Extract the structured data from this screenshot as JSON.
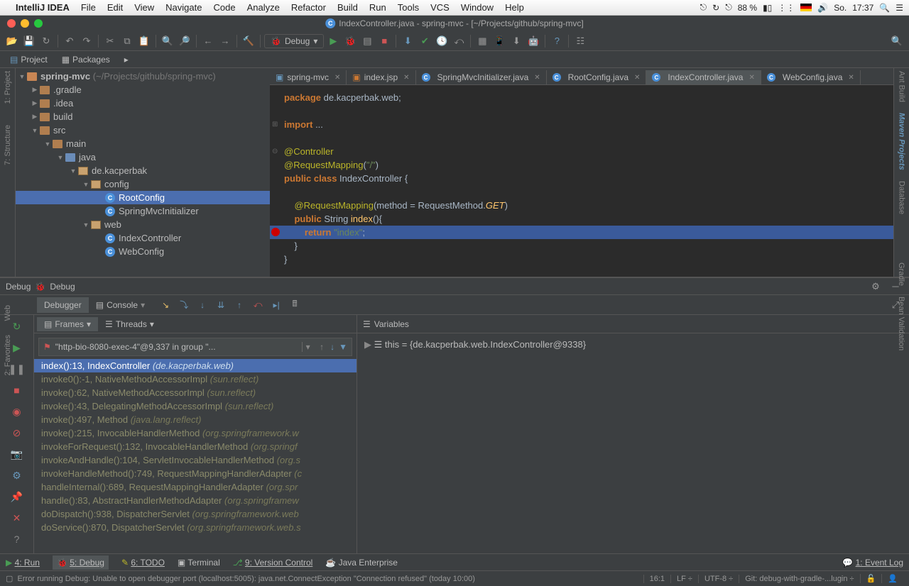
{
  "mac": {
    "app": "IntelliJ IDEA",
    "menus": [
      "File",
      "Edit",
      "View",
      "Navigate",
      "Code",
      "Analyze",
      "Refactor",
      "Build",
      "Run",
      "Tools",
      "VCS",
      "Window",
      "Help"
    ],
    "battery": "88 %",
    "day": "So.",
    "time": "17:37"
  },
  "window": {
    "title": "IndexController.java - spring-mvc - [~/Projects/github/spring-mvc]"
  },
  "toolbar": {
    "debug_config": "Debug"
  },
  "nav": {
    "project": "Project",
    "packages": "Packages"
  },
  "side": {
    "project": "1: Project",
    "structure": "7: Structure",
    "web": "Web",
    "favorites": "2: Favorites",
    "ant": "Ant Build",
    "maven": "Maven Projects",
    "database": "Database",
    "gradle": "Gradle",
    "bean": "Bean Validation"
  },
  "tree": {
    "root": "spring-mvc",
    "root_hint": "(~/Projects/github/spring-mvc)",
    "n_gradle": ".gradle",
    "n_idea": ".idea",
    "n_build": "build",
    "n_src": "src",
    "n_main": "main",
    "n_java": "java",
    "n_pkg": "de.kacperbak",
    "n_config": "config",
    "n_root": "RootConfig",
    "n_init": "SpringMvcInitializer",
    "n_web": "web",
    "n_idx": "IndexController",
    "n_webcfg": "WebConfig"
  },
  "tabs": [
    {
      "label": "spring-mvc",
      "kind": "module"
    },
    {
      "label": "index.jsp",
      "kind": "jsp"
    },
    {
      "label": "SpringMvcInitializer.java",
      "kind": "class"
    },
    {
      "label": "RootConfig.java",
      "kind": "class"
    },
    {
      "label": "IndexController.java",
      "kind": "class",
      "active": true
    },
    {
      "label": "WebConfig.java",
      "kind": "class"
    }
  ],
  "code": {
    "l1a": "package ",
    "l1b": "de.kacperbak.web;",
    "l2a": "import ",
    "l2b": "...",
    "l3": "@Controller",
    "l4a": "@RequestMapping",
    "l4b": "(",
    "l4c": "\"/\"",
    "l4d": ")",
    "l5a": "public class ",
    "l5b": "IndexController {",
    "l6a": "    @RequestMapping",
    "l6b": "(",
    "l6c": "method ",
    "l6d": "= RequestMethod.",
    "l6e": "GET",
    "l6f": ")",
    "l7a": "    public ",
    "l7b": "String ",
    "l7c": "index",
    "l7d": "(){",
    "l8a": "        return ",
    "l8b": "\"index\"",
    "l8c": ";",
    "l9": "    }",
    "l10": "}"
  },
  "debug": {
    "header": "Debug",
    "console": "Console",
    "debugger": "Debugger",
    "frames_tab": "Frames",
    "threads_tab": "Threads",
    "vars_tab": "Variables",
    "thread": "\"http-bio-8080-exec-4\"@9,337 in group \"...",
    "frames": [
      {
        "m": "index():13, IndexController",
        "p": "(de.kacperbak.web)",
        "sel": true
      },
      {
        "m": "invoke0():-1, NativeMethodAccessorImpl",
        "p": "(sun.reflect)"
      },
      {
        "m": "invoke():62, NativeMethodAccessorImpl",
        "p": "(sun.reflect)"
      },
      {
        "m": "invoke():43, DelegatingMethodAccessorImpl",
        "p": "(sun.reflect)"
      },
      {
        "m": "invoke():497, Method",
        "p": "(java.lang.reflect)"
      },
      {
        "m": "invoke():215, InvocableHandlerMethod",
        "p": "(org.springframework.w"
      },
      {
        "m": "invokeForRequest():132, InvocableHandlerMethod",
        "p": "(org.springf"
      },
      {
        "m": "invokeAndHandle():104, ServletInvocableHandlerMethod",
        "p": "(org.s"
      },
      {
        "m": "invokeHandleMethod():749, RequestMappingHandlerAdapter",
        "p": "(c"
      },
      {
        "m": "handleInternal():689, RequestMappingHandlerAdapter",
        "p": "(org.spr"
      },
      {
        "m": "handle():83, AbstractHandlerMethodAdapter",
        "p": "(org.springframew"
      },
      {
        "m": "doDispatch():938, DispatcherServlet",
        "p": "(org.springframework.web"
      },
      {
        "m": "doService():870, DispatcherServlet",
        "p": "(org.springframework.web.s"
      }
    ],
    "variable": "this = {de.kacperbak.web.IndexController@9338}"
  },
  "bottom": {
    "run": "4: Run",
    "debug": "5: Debug",
    "todo": "6: TODO",
    "terminal": "Terminal",
    "vcs": "9: Version Control",
    "jee": "Java Enterprise",
    "event": "1: Event Log"
  },
  "status": {
    "msg": "Error running Debug: Unable to open debugger port (localhost:5005): java.net.ConnectException \"Connection refused\" (today 10:00)",
    "pos": "16:1",
    "lf": "LF",
    "enc": "UTF-8",
    "git": "Git: debug-with-gradle-...lugin"
  }
}
